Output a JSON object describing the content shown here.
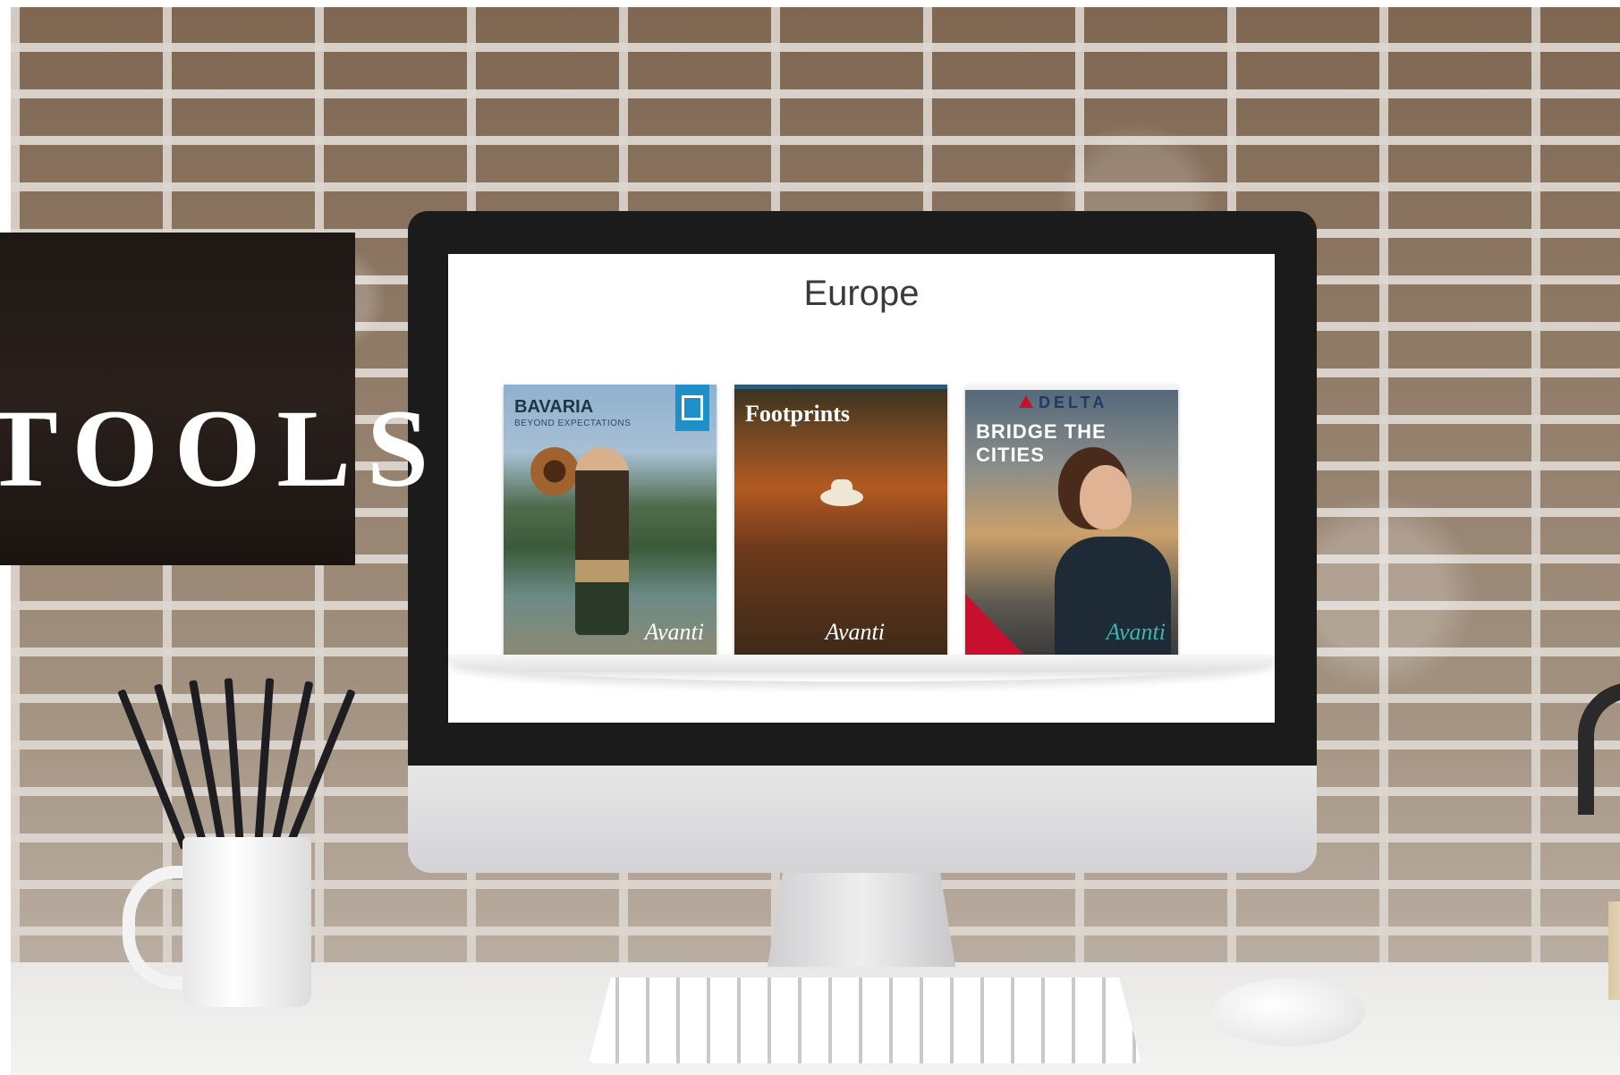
{
  "overlay": {
    "title": "TOOLS"
  },
  "screen": {
    "heading": "Europe",
    "brochures": [
      {
        "title": "BAVARIA",
        "subtitle": "BEYOND EXPECTATIONS",
        "brand": "Avanti"
      },
      {
        "title": "Footprints",
        "subtitle": "",
        "brand": "Avanti"
      },
      {
        "logo": "DELTA",
        "title": "BRIDGE THE CITIES",
        "brand": "Avanti"
      }
    ]
  },
  "colors": {
    "tools_panel": "#1e1714",
    "delta_red": "#c8102e",
    "badge_blue": "#1e8fc8"
  }
}
